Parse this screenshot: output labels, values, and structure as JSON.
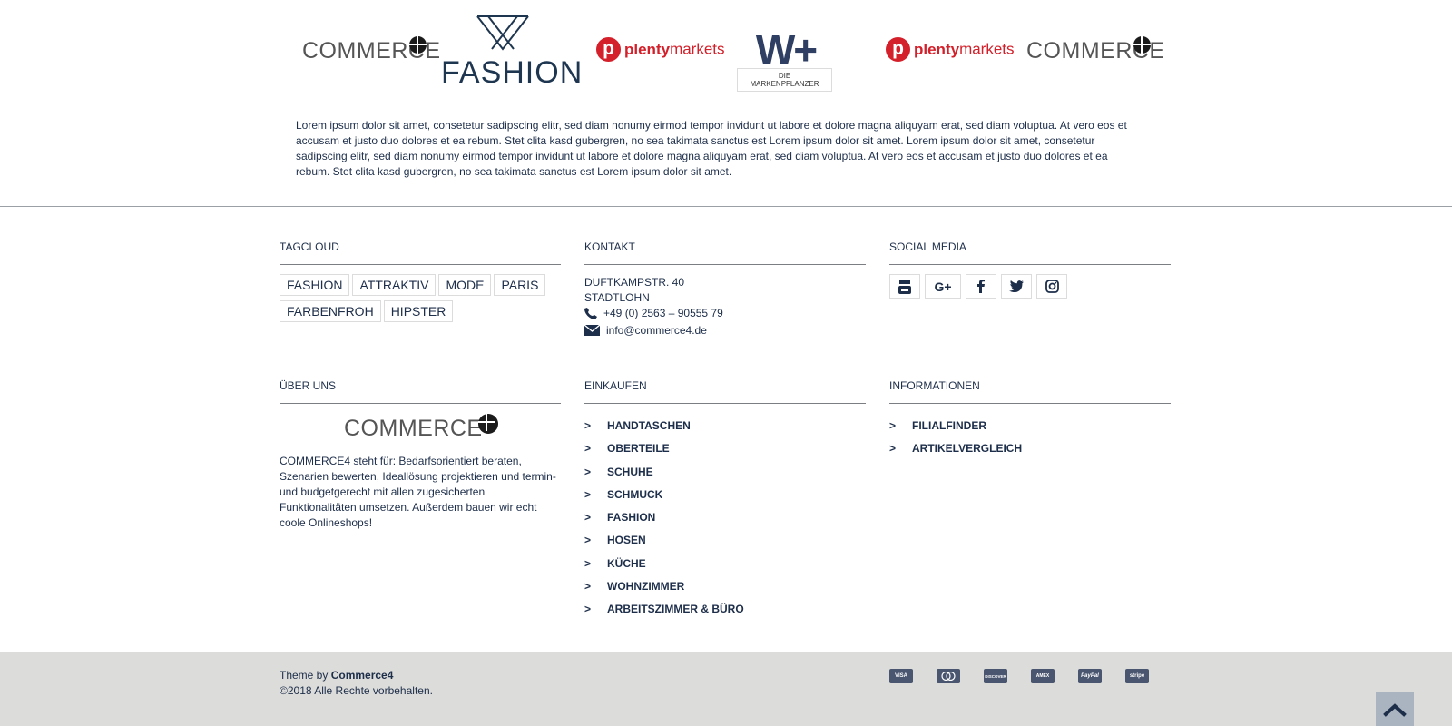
{
  "brand_logos": [
    {
      "name": "commerce4-logo",
      "text": "COMMERCE"
    },
    {
      "name": "fashion-logo",
      "text": "FASHION"
    },
    {
      "name": "plentymarkets-logo",
      "text_a": "plenty",
      "text_b": "markets"
    },
    {
      "name": "wplus-logo",
      "text": "W+",
      "tagline": "Die MARKENpflanzer"
    },
    {
      "name": "plentymarkets-logo-2",
      "text_a": "plenty",
      "text_b": "markets"
    },
    {
      "name": "commerce4-logo-2",
      "text": "COMMERCE"
    }
  ],
  "intro_text": "Lorem ipsum dolor sit amet, consetetur sadipscing elitr, sed diam nonumy eirmod tempor invidunt ut labore et dolore magna aliquyam erat, sed diam voluptua. At vero eos et accusam et justo duo dolores et ea rebum. Stet clita kasd gubergren, no sea takimata sanctus est Lorem ipsum dolor sit amet. Lorem ipsum dolor sit amet, consetetur sadipscing elitr, sed diam nonumy eirmod tempor invidunt ut labore et dolore magna aliquyam erat, sed diam voluptua. At vero eos et accusam et justo duo dolores et ea rebum. Stet clita kasd gubergren, no sea takimata sanctus est Lorem ipsum dolor sit amet.",
  "tagcloud": {
    "title": "TAGCLOUD",
    "tags": [
      "FASHION",
      "ATTRAKTIV",
      "MODE",
      "PARIS",
      "FARBENFROH",
      "HIPSTER"
    ]
  },
  "contact": {
    "title": "KONTAKT",
    "street": "DUFTKAMPSTR. 40",
    "city": "STADTLOHN",
    "phone": "+49 (0) 2563 – 90555 79",
    "email": "info@commerce4.de"
  },
  "social": {
    "title": "SOCIAL MEDIA",
    "icons": [
      "youtube-icon",
      "google-plus-icon",
      "facebook-icon",
      "twitter-icon",
      "instagram-icon"
    ],
    "google_label": "G+"
  },
  "about": {
    "title": "ÜBER UNS",
    "logo_text": "COMMERCE",
    "text": "COMMERCE4 steht für: Bedarfsorientiert beraten, Szenarien bewerten, Ideallösung projektieren und termin- und budgetgerecht mit allen zugesicherten Funktionalitäten umsetzen. Außerdem bauen wir echt coole Onlineshops!"
  },
  "einkaufen": {
    "title": "EINKAUFEN",
    "chevron": ">",
    "items": [
      "HANDTASCHEN",
      "OBERTEILE",
      "SCHUHE",
      "SCHMUCK",
      "FASHION",
      "HOSEN",
      "KÜCHE",
      "WOHNZIMMER",
      "ARBEITSZIMMER & BÜRO"
    ]
  },
  "informationen": {
    "title": "INFORMATIONEN",
    "chevron": ">",
    "items": [
      "FILIALFINDER",
      "ARTIKELVERGLEICH"
    ]
  },
  "footer": {
    "theme_prefix": "Theme by",
    "theme_name": "Commerce4",
    "copyright": "©2018 Alle Rechte vorbehalten.",
    "payment_icons": [
      "visa-icon",
      "mastercard-icon",
      "discover-icon",
      "amex-icon",
      "paypal-icon",
      "stripe-icon"
    ],
    "payment_labels": [
      "VISA",
      "MC",
      "DISCOVER",
      "AMEX",
      "PayPal",
      "stripe"
    ]
  },
  "colors": {
    "text": "#1d2e4a",
    "bottom_bar": "#dcdcda",
    "plenty_red": "#d4202a",
    "scroll_top": "#aab4c0"
  }
}
